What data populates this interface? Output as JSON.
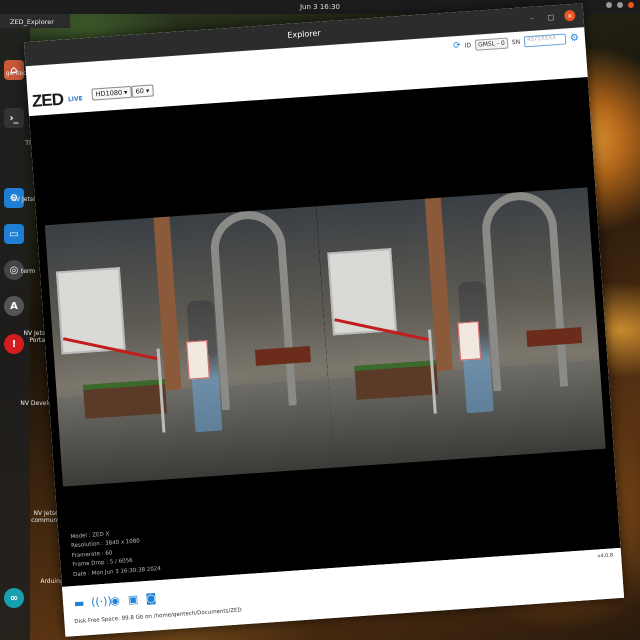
{
  "system": {
    "clock": "Jun 3  16:30",
    "app_menu": "ZED_Explorer"
  },
  "desktop": {
    "labels": [
      "gentech",
      "TI",
      "NV Jetson",
      "term",
      "NV Jetson Portal",
      "NV Develop",
      "NV Jetson community",
      "Arduino IDE"
    ]
  },
  "window": {
    "title": "Explorer",
    "controls": {
      "minimize": "–",
      "maximize": "□",
      "close": "×"
    }
  },
  "header": {
    "id_label": "ID",
    "id_value": "GMSL - 0",
    "sn_label": "SN",
    "sn_placeholder": "4572XXXX"
  },
  "toolbar": {
    "logo": "ZED",
    "live": "LIVE",
    "resolution": "HD1080",
    "fps": "60"
  },
  "info": {
    "model": "Model : ZED X",
    "resolution": "Resolution : 3840 x 1080",
    "framerate": "Framerate : 60",
    "frame_drop": "Frame Drop : 5 / 6056",
    "date": "Date : Mon Jun 3 16:30:38 2024"
  },
  "footer": {
    "disk_space": "Disk Free Space: 99.8 Gb on /home/gentech/Documents/ZED",
    "version": "v4.0.8"
  }
}
